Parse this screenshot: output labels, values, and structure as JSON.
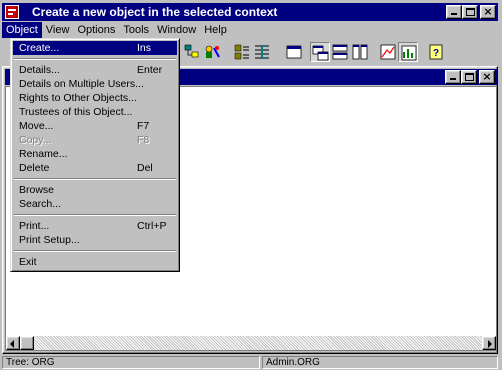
{
  "window": {
    "title": "Create a new object in the selected context",
    "app_icon": "netware-administrator-icon"
  },
  "menubar": {
    "items": [
      "Object",
      "View",
      "Options",
      "Tools",
      "Window",
      "Help"
    ],
    "active": "Object"
  },
  "toolbar": {
    "buttons": [
      "tree-icon",
      "users-icon",
      "grid-view-icon",
      "list-view-icon",
      "window-icon",
      "cascade-icon",
      "tile-icon",
      "chart-icon",
      "chart-alt-icon",
      "help-icon"
    ]
  },
  "object_menu": {
    "groups": [
      [
        {
          "label": "Create...",
          "shortcut": "Ins",
          "highlighted": true
        }
      ],
      [
        {
          "label": "Details...",
          "shortcut": "Enter"
        },
        {
          "label": "Details on Multiple Users...",
          "shortcut": ""
        },
        {
          "label": "Rights to Other Objects...",
          "shortcut": ""
        },
        {
          "label": "Trustees of this Object...",
          "shortcut": ""
        },
        {
          "label": "Move...",
          "shortcut": "F7"
        },
        {
          "label": "Copy...",
          "shortcut": "F8",
          "disabled": true
        },
        {
          "label": "Rename...",
          "shortcut": ""
        },
        {
          "label": "Delete",
          "shortcut": "Del"
        }
      ],
      [
        {
          "label": "Browse",
          "shortcut": ""
        },
        {
          "label": "Search...",
          "shortcut": ""
        }
      ],
      [
        {
          "label": "Print...",
          "shortcut": "Ctrl+P"
        },
        {
          "label": "Print Setup...",
          "shortcut": ""
        }
      ],
      [
        {
          "label": "Exit",
          "shortcut": ""
        }
      ]
    ]
  },
  "statusbar": {
    "tree": "Tree: ORG",
    "user": "Admin.ORG"
  },
  "colors": {
    "title_bar": "#000080",
    "face": "#c0c0c0",
    "highlight": "#000080"
  }
}
